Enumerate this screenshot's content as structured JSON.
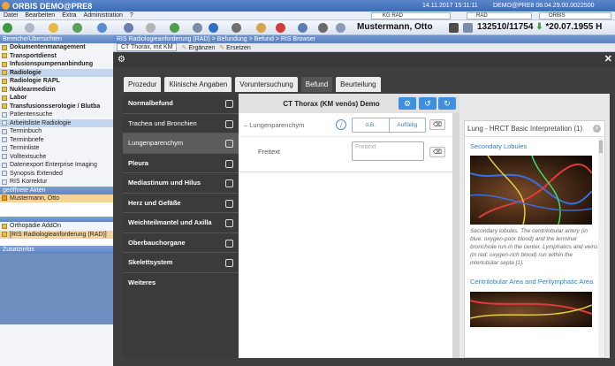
{
  "titlebar": {
    "app": "ORBIS DEMO@PRE8",
    "datetime": "14.11.2017 15:11:11",
    "session": "DEMO@PRE8 08.04.29.00.0022500"
  },
  "menu": [
    "Datei",
    "Bearbeiten",
    "Extra",
    "Administration",
    "?"
  ],
  "menubar_fields": {
    "kg": "KG RAD",
    "rad": "RAD",
    "orbis": "ORBIS"
  },
  "toolbar": {
    "patient": "Mustermann, Otto",
    "case": "132510/11754",
    "dob": "*20.07.1955 H"
  },
  "left": {
    "section1": "Bereiche/Übersichten",
    "modules": [
      {
        "label": "Dokumentenmanagement",
        "bold": true
      },
      {
        "label": "Transportdienst",
        "bold": true
      },
      {
        "label": "Infusionspumpenanbindung",
        "bold": true
      },
      {
        "label": "Radiologie",
        "bold": true
      },
      {
        "label": "Radiologie RAPL",
        "bold": true
      },
      {
        "label": "Nuklearmedizin",
        "bold": true
      },
      {
        "label": "Labor",
        "bold": true
      },
      {
        "label": "Transfusionsserologie / Blutba",
        "bold": true
      }
    ],
    "subitems": [
      "Patientensuche",
      "Arbeitsliste Radiologie",
      "Terminbuch",
      "Terminbriefe",
      "Terminliste",
      "Volltextsuche",
      "Datenexport Enterprise Imaging",
      "Synopsis Extended",
      "RIS Korrektur"
    ],
    "section2": "geöffnete Akten",
    "open_patient": "Mustermann, Otto",
    "addons": [
      "Orthopädie AddOn",
      "[RIS Radiologieanforderung (RAD)]"
    ],
    "section3": "Zusatzinfos"
  },
  "breadcrumb": "RIS Radiologieanforderung (RAD) > Befundung > Befund > RIS Browser",
  "subbar": {
    "doc": "CT Thorax, mit KM",
    "add": "Ergänzen",
    "replace": "Ersetzen"
  },
  "tabs": [
    {
      "label": "Prozedur",
      "active": false
    },
    {
      "label": "Klinische Angaben",
      "active": false
    },
    {
      "label": "Voruntersuchung",
      "active": false
    },
    {
      "label": "Befund",
      "active": true
    },
    {
      "label": "Beurteilung",
      "active": false
    }
  ],
  "categories": [
    {
      "label": "Normalbefund",
      "bold": true,
      "selected": false
    },
    {
      "label": "Trachea und Bronchien",
      "bold": false,
      "selected": false
    },
    {
      "label": "Lungenparenchym",
      "bold": false,
      "selected": true
    },
    {
      "label": "Pleura",
      "bold": true,
      "selected": false
    },
    {
      "label": "Mediastinum und Hilus",
      "bold": true,
      "selected": false
    },
    {
      "label": "Herz und Gefäße",
      "bold": true,
      "selected": false
    },
    {
      "label": "Weichteilmantel und Axilla",
      "bold": true,
      "selected": false
    },
    {
      "label": "Oberbauchorgane",
      "bold": true,
      "selected": false
    },
    {
      "label": "Skelettsystem",
      "bold": true,
      "selected": false
    },
    {
      "label": "Weiteres",
      "bold": true,
      "selected": false
    }
  ],
  "middle": {
    "header": "CT Thorax (KM venös) Demo",
    "lung_label": "– Lungenparenchym",
    "ob": "o.B.",
    "auffaellig": "Auffällig",
    "freitext_label": "Freitext",
    "freitext_placeholder": "Freitext"
  },
  "rightpanel": {
    "title": "Lung - HRCT Basic Interpretation (1)",
    "link1": "Secondary Lobules",
    "caption1": "Secondary lobules. The centrilobular artery (in blue: oxygen-poor blood) and the terminal bronchiole run in the center. Lymphatics and veins (in red: oxygen-rich blood) run within the interlobular septa [1].",
    "link2": "Centrilobular Area and Perilymphatic Area"
  },
  "colors": {
    "accent": "#3e8fe0",
    "link": "#2f83c9",
    "nav_header": "#5f86c4"
  }
}
